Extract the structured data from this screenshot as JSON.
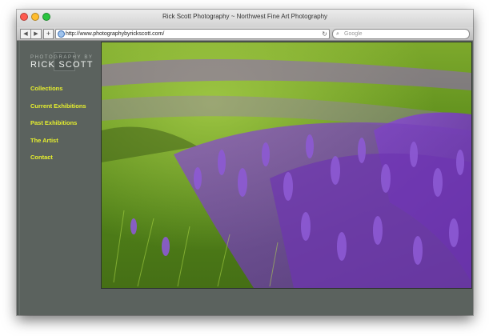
{
  "window": {
    "title": "Rick Scott Photography ~ Northwest Fine Art Photography",
    "back_icon": "back-arrow-icon",
    "forward_icon": "forward-arrow-icon",
    "add_bookmark_label": "+",
    "url": "http://www.photographybyrickscott.com/",
    "reload_icon": "reload-icon",
    "search_placeholder": "Google"
  },
  "site": {
    "logo_top": "PHOTOGRAPHY BY",
    "logo_name": "RICK SCOTT",
    "nav": [
      {
        "label": "Collections"
      },
      {
        "label": "Current Exhibitions"
      },
      {
        "label": "Past Exhibitions"
      },
      {
        "label": "The Artist"
      },
      {
        "label": "Contact"
      }
    ]
  },
  "colors": {
    "page_background": "#5b625e",
    "nav_link": "#e6ef2e",
    "lavender": "#7b3fc0",
    "grass": "#6f9a1e"
  }
}
